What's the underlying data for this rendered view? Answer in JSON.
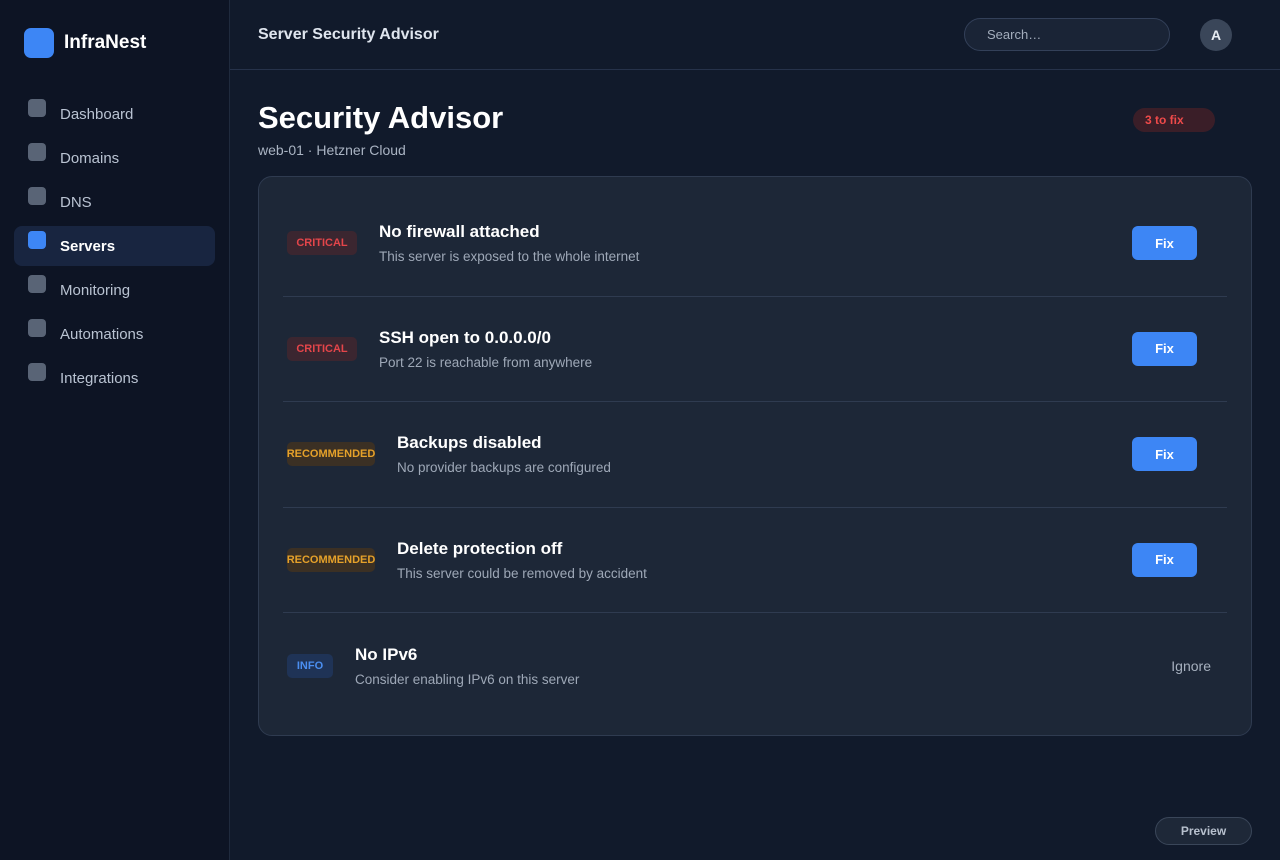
{
  "brand": {
    "name": "InfraNest"
  },
  "sidebar": {
    "items": [
      {
        "label": "Dashboard",
        "active": false
      },
      {
        "label": "Domains",
        "active": false
      },
      {
        "label": "DNS",
        "active": false
      },
      {
        "label": "Servers",
        "active": true
      },
      {
        "label": "Monitoring",
        "active": false
      },
      {
        "label": "Automations",
        "active": false
      },
      {
        "label": "Integrations",
        "active": false
      }
    ]
  },
  "topbar": {
    "title": "Server Security Advisor",
    "search_placeholder": "Search…",
    "avatar_initial": "A"
  },
  "page": {
    "title": "Security Advisor",
    "subtitle": "web-01 · Hetzner Cloud",
    "badge": "3 to fix"
  },
  "findings": [
    {
      "severity": "CRITICAL",
      "level": "critical",
      "title": "No firewall attached",
      "description": "This server is exposed to the whole internet",
      "action": "Fix"
    },
    {
      "severity": "CRITICAL",
      "level": "critical",
      "title": "SSH open to 0.0.0.0/0",
      "description": "Port 22 is reachable from anywhere",
      "action": "Fix"
    },
    {
      "severity": "RECOMMENDED",
      "level": "recommended",
      "title": "Backups disabled",
      "description": "No provider backups are configured",
      "action": "Fix"
    },
    {
      "severity": "RECOMMENDED",
      "level": "recommended",
      "title": "Delete protection off",
      "description": "This server could be removed by accident",
      "action": "Fix"
    },
    {
      "severity": "INFO",
      "level": "info",
      "title": "No IPv6",
      "description": "Consider enabling IPv6 on this server",
      "action": "Ignore"
    }
  ],
  "footer": {
    "preview_label": "Preview"
  },
  "colors": {
    "accent": "#3d86f5",
    "critical": "#e4454a",
    "recommended": "#e5a12a",
    "info": "#4b8ef0"
  }
}
